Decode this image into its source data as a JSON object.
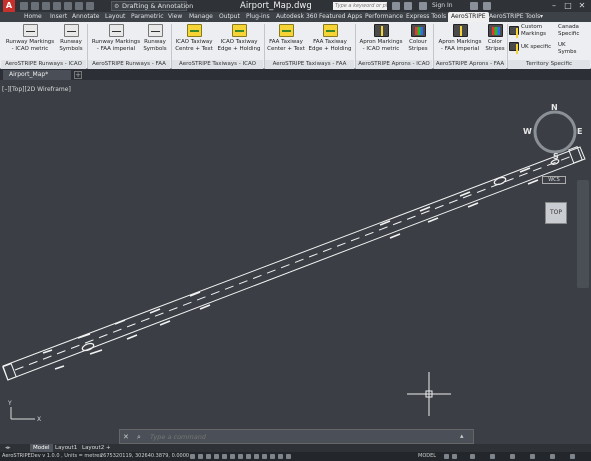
{
  "title_bar": {
    "app_logo": "A",
    "workspace": "Drafting & Annotation",
    "document_title": "Airport_Map.dwg",
    "search_placeholder": "Type a keyword or phrase",
    "sign_in": "Sign In"
  },
  "ribbon_tabs": [
    "Home",
    "Insert",
    "Annotate",
    "Layout",
    "Parametric",
    "View",
    "Manage",
    "Output",
    "Plug-ins",
    "Autodesk 360",
    "Featured Apps",
    "Performance",
    "Express Tools",
    "AeroSTRIPE",
    "AeroSTRIPE Tools"
  ],
  "active_tab": "AeroSTRIPE",
  "ribbon": {
    "buttons": [
      {
        "label1": "Runway Markings",
        "label2": "- ICAO metric",
        "icon": "runway-markings-icon"
      },
      {
        "label1": "Runway",
        "label2": "Symbols",
        "icon": "runway-symbols-icon"
      },
      {
        "label1": "Runway Markings",
        "label2": "- FAA imperial",
        "icon": "runway-markings-faa-icon"
      },
      {
        "label1": "Runway",
        "label2": "Symbols",
        "icon": "runway-symbols-faa-icon"
      },
      {
        "label1": "ICAO Taxiway",
        "label2": "Centre + Text",
        "icon": "taxiway-centre-icon"
      },
      {
        "label1": "ICAO Taxiway",
        "label2": "Edge + Holding",
        "icon": "taxiway-edge-icon"
      },
      {
        "label1": "FAA Taxiway",
        "label2": "Center + Text",
        "icon": "faa-taxiway-center-icon"
      },
      {
        "label1": "FAA Taxiway",
        "label2": "Edge + Holding",
        "icon": "faa-taxiway-edge-icon"
      },
      {
        "label1": "Apron Markings",
        "label2": "- ICAO metric",
        "icon": "apron-markings-icon"
      },
      {
        "label1": "Colour",
        "label2": "Stripes",
        "icon": "colour-stripes-icon"
      },
      {
        "label1": "Apron Markings",
        "label2": "- FAA imperial",
        "icon": "apron-markings-faa-icon"
      },
      {
        "label1": "Color",
        "label2": "Stripes",
        "icon": "color-stripes-icon"
      }
    ],
    "territory": {
      "custom": "Custom Markings",
      "canada": "Canada Specific",
      "uk": "UK specific",
      "uk_symb": "UK Symbs"
    },
    "groups": [
      "AeroSTRIPE Runways - ICAO",
      "AeroSTRIPE Runways - FAA",
      "AeroSTRIPE Taxiways - ICAO",
      "AeroSTRIPE Taxiways - FAA",
      "AeroSTRIPE Aprons - ICAO",
      "AeroSTRIPE Aprons - FAA",
      "Territory Specific"
    ]
  },
  "file_tab": "Airport_Map*",
  "viewport": {
    "label": "[–][Top][2D Wireframe]",
    "viewcube": {
      "top": "TOP",
      "n": "N",
      "s": "S",
      "e": "E",
      "w": "W",
      "wcs": "WCS"
    }
  },
  "command_line": {
    "placeholder": "Type a command"
  },
  "layout_tabs": [
    "Model",
    "Layout1",
    "Layout2"
  ],
  "active_layout": "Model",
  "status_bar": {
    "version": "AeroSTRIPEDev v 1.0.0 , Units = metres",
    "coords": "2675320119, 302640.3879, 0.0000",
    "model": "MODEL"
  },
  "colors": {
    "canvas": "#3b3f45",
    "ribbon": "#eceef1",
    "runway_lines": "#f2f2f2"
  }
}
